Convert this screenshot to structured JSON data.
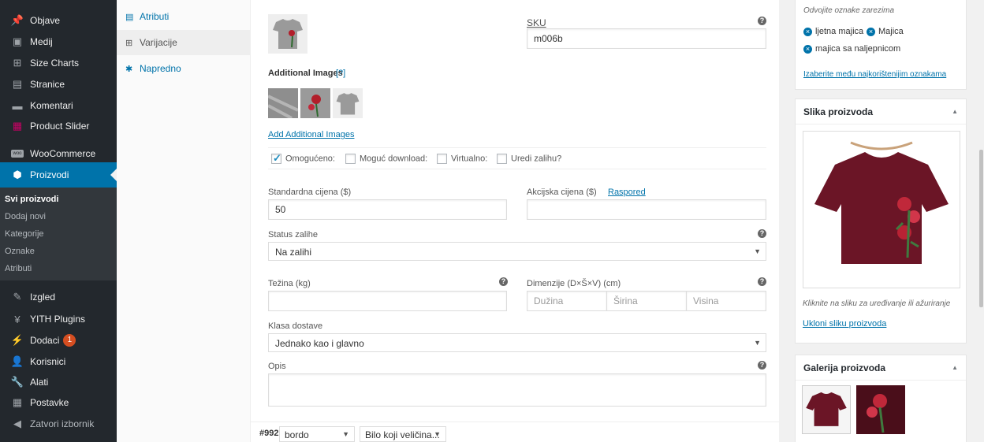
{
  "admin_menu": {
    "items": [
      {
        "label": "Objave",
        "icon": "pin-icon"
      },
      {
        "label": "Medij",
        "icon": "media-icon"
      },
      {
        "label": "Size Charts",
        "icon": "grid-icon"
      },
      {
        "label": "Stranice",
        "icon": "page-icon"
      },
      {
        "label": "Komentari",
        "icon": "comment-icon"
      },
      {
        "label": "Product Slider",
        "icon": "slider-icon"
      },
      {
        "label": "WooCommerce",
        "icon": "woocommerce-icon"
      },
      {
        "label": "Proizvodi",
        "icon": "products-icon"
      },
      {
        "label": "Izgled",
        "icon": "brush-icon"
      },
      {
        "label": "YITH Plugins",
        "icon": "yith-icon"
      },
      {
        "label": "Dodaci",
        "icon": "plugin-icon",
        "badge": "1"
      },
      {
        "label": "Korisnici",
        "icon": "users-icon"
      },
      {
        "label": "Alati",
        "icon": "wrench-icon"
      },
      {
        "label": "Postavke",
        "icon": "settings-icon"
      },
      {
        "label": "Zatvori izbornik",
        "icon": "collapse-icon"
      }
    ],
    "submenu": [
      "Svi proizvodi",
      "Dodaj novi",
      "Kategorije",
      "Oznake",
      "Atributi"
    ]
  },
  "product_tabs": [
    {
      "label": "Atributi",
      "icon": "list-icon"
    },
    {
      "label": "Varijacije",
      "icon": "grid-icon"
    },
    {
      "label": "Napredno",
      "icon": "gear-icon"
    }
  ],
  "variation": {
    "sku_label": "SKU",
    "sku_value": "m006b",
    "additional_images_label": "Additional Images",
    "help_link": "[?]",
    "add_images_link": "Add Additional Images",
    "checks": [
      {
        "label": "Omogućeno:",
        "checked": true
      },
      {
        "label": "Moguć download:",
        "checked": false
      },
      {
        "label": "Virtualno:",
        "checked": false
      },
      {
        "label": "Uredi zalihu?",
        "checked": false
      }
    ],
    "regular_price_label": "Standardna cijena ($)",
    "regular_price_value": "50",
    "sale_price_label": "Akcijska cijena ($)",
    "schedule_link": "Raspored",
    "stock_status_label": "Status zalihe",
    "stock_status_value": "Na zalihi",
    "weight_label": "Težina (kg)",
    "dimensions_label": "Dimenzije (D×Š×V) (cm)",
    "length_placeholder": "Dužina",
    "width_placeholder": "Širina",
    "height_placeholder": "Visina",
    "shipping_class_label": "Klasa dostave",
    "shipping_class_value": "Jednako kao i glavno",
    "description_label": "Opis"
  },
  "next_variation": {
    "id": "#992",
    "color": "bordo",
    "size": "Bilo koji veličina..."
  },
  "sidebar": {
    "tags_hint": "Odvojite oznake zarezima",
    "tags": [
      "ljetna majica",
      "Majica",
      "majica sa naljepnicom"
    ],
    "choose_tags_link": "Izaberite među najkorištenijim oznakama",
    "image_box_title": "Slika proizvoda",
    "image_hint": "Kliknite na sliku za uređivanje ili ažuriranje",
    "remove_image_link": "Ukloni sliku proizvoda",
    "gallery_box_title": "Galerija proizvoda"
  },
  "colors": {
    "accent": "#0073aa",
    "menu_bg": "#23282d",
    "shirt": "#6b1526"
  }
}
